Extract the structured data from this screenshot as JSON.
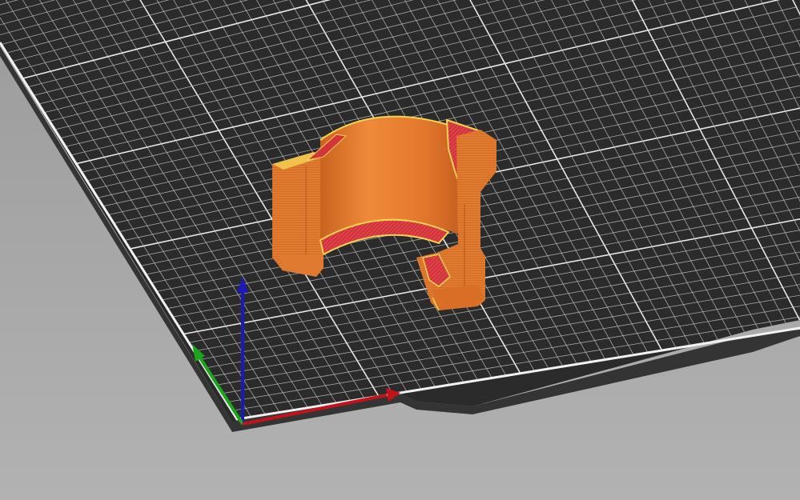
{
  "viewport": {
    "kind": "3D slicer plate preview",
    "background_color": "#a3a3a3",
    "bed_color": "#2a2a2a",
    "bed_edge_color": "#2f2f2f",
    "grid_minor_color": "#bcbcbc",
    "grid_major_color": "#e6e6e6"
  },
  "model": {
    "shape": "open ring clip",
    "color_outer": "#e27a2f",
    "color_inner": "#e48034",
    "color_infill": "#d4333a",
    "color_perimeter": "#f1cf4b"
  },
  "axes": {
    "x_color": "#c3131a",
    "y_color": "#1aa51a",
    "z_color": "#1a1ab8"
  }
}
